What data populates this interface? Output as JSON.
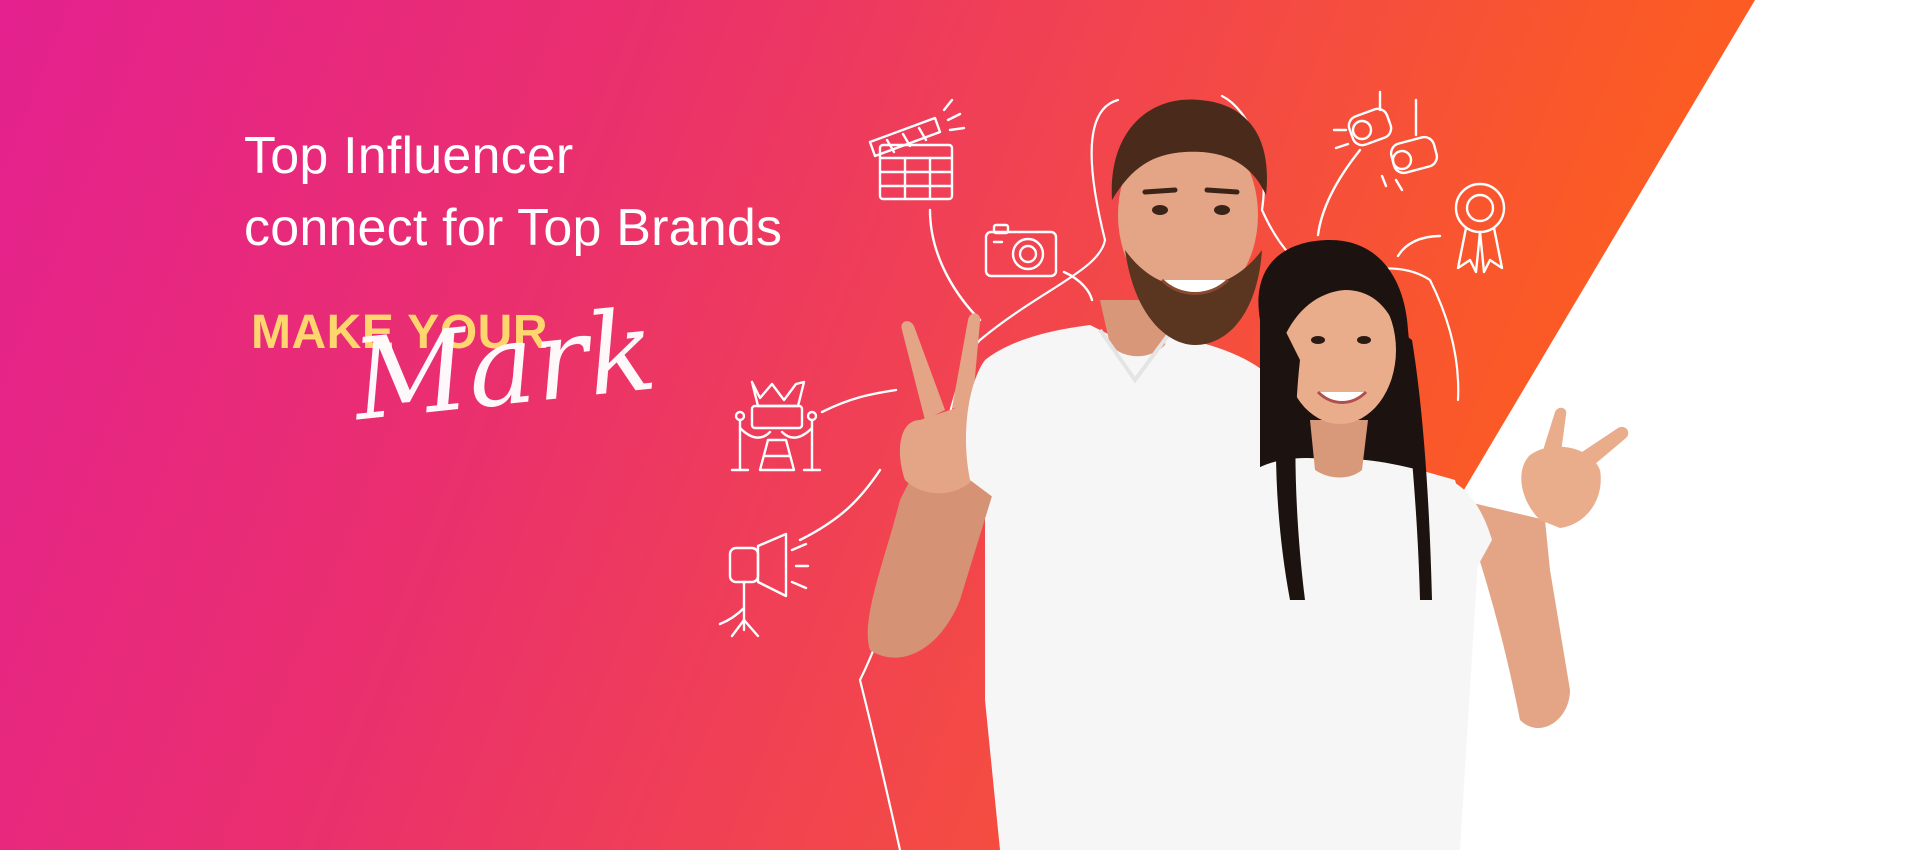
{
  "hero": {
    "headline_line1": "Top Influencer",
    "headline_line2": "connect for Top Brands",
    "tagline_top": "MAKE YOUR",
    "tagline_script": "Mark"
  },
  "icons": [
    "clapperboard-icon",
    "photo-camera-icon",
    "stage-spotlights-icon",
    "award-ribbon-icon",
    "vip-red-carpet-icon",
    "studio-light-icon"
  ],
  "colors": {
    "gradient_start": "#e4218f",
    "gradient_end": "#ff6c10",
    "tagline_yellow": "#ffd66e",
    "text_white": "#ffffff",
    "shirt_white": "#f6f6f6"
  }
}
